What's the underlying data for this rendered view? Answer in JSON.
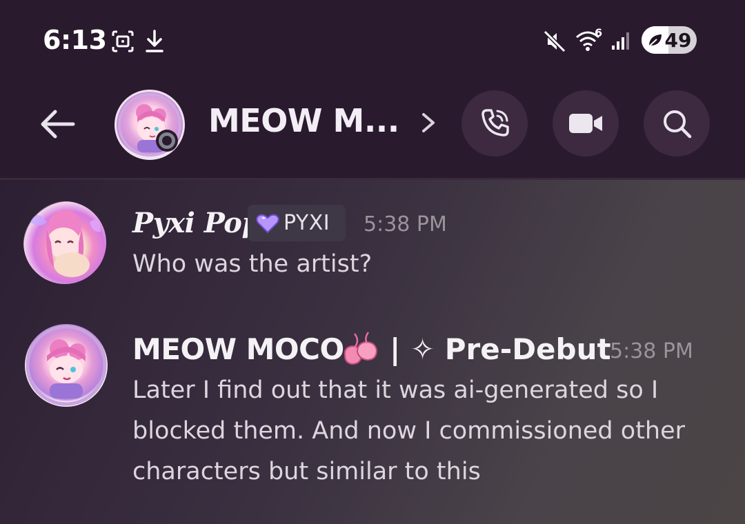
{
  "status_bar": {
    "time": "6:13",
    "wifi_label": "6",
    "battery": "49",
    "battery_level": 0.49
  },
  "header": {
    "channel_name": "MEOW M...",
    "icons": [
      "back-arrow-icon",
      "chevron-right-icon",
      "phone-call-icon",
      "video-camera-icon",
      "search-icon"
    ]
  },
  "messages": [
    {
      "username": "Pyxi Pop",
      "tag": "PYXI",
      "time": "5:38 PM",
      "text": "Who was the artist?"
    },
    {
      "username": "MEOW MOCO",
      "role_suffix": "| ✧ Pre-Debut",
      "time": "5:38 PM",
      "lines": [
        "Later I find out that it was ai-generated so I",
        "blocked them. And now I commissioned other",
        "characters but similar to this"
      ]
    }
  ],
  "colors": {
    "header_bg": "#2a1a2e",
    "button_bg": "#3d2a40",
    "timestamp": "#9a949c",
    "message_text": "#dcd6de"
  }
}
